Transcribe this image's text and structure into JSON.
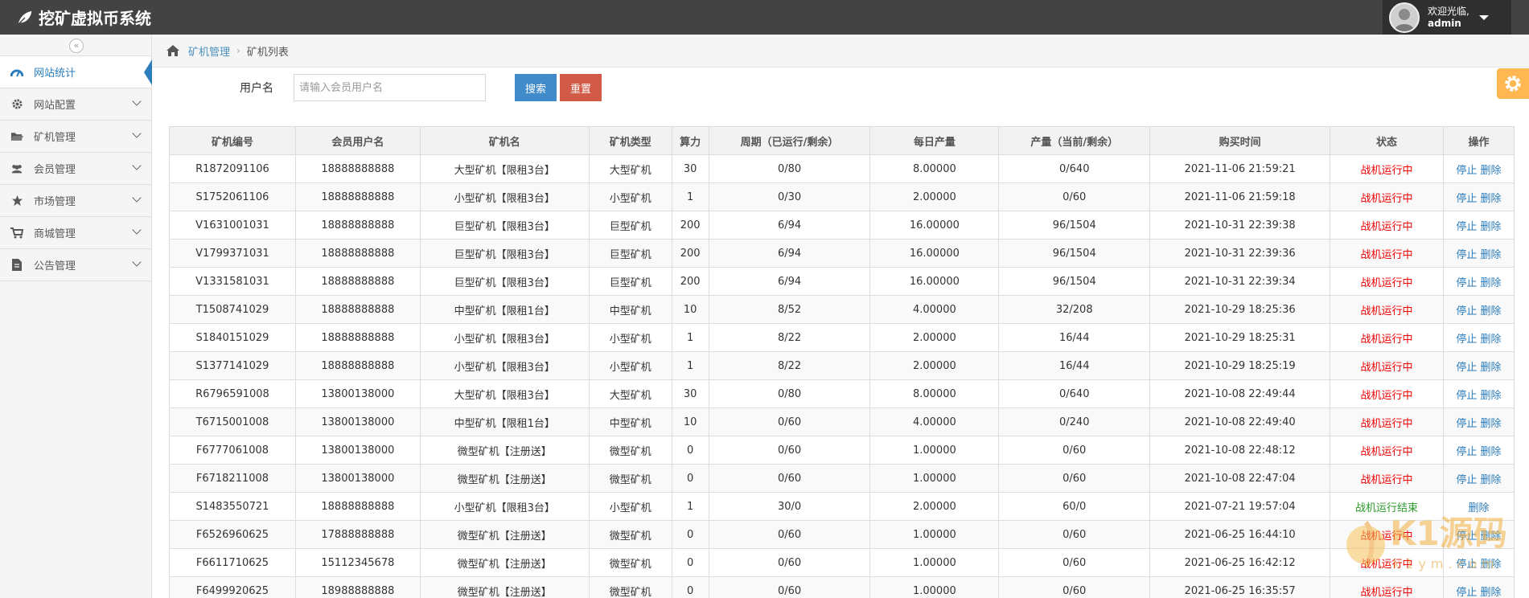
{
  "header": {
    "title": "挖矿虚拟币系统",
    "welcome": "欢迎光临,",
    "username": "admin"
  },
  "sidebar": {
    "collapse_icon": "«",
    "items": [
      {
        "label": "网站统计",
        "icon": "dashboard-icon",
        "active": true
      },
      {
        "label": "网站配置",
        "icon": "gear-icon"
      },
      {
        "label": "矿机管理",
        "icon": "folder-icon"
      },
      {
        "label": "会员管理",
        "icon": "users-icon"
      },
      {
        "label": "市场管理",
        "icon": "star-icon"
      },
      {
        "label": "商城管理",
        "icon": "cart-icon"
      },
      {
        "label": "公告管理",
        "icon": "document-icon"
      }
    ]
  },
  "breadcrumb": {
    "parent": "矿机管理",
    "sep": "›",
    "current": "矿机列表"
  },
  "search": {
    "label": "用户名",
    "placeholder": "请输入会员用户名",
    "search_btn": "搜索",
    "reset_btn": "重置"
  },
  "table": {
    "columns": [
      "矿机编号",
      "会员用户名",
      "矿机名",
      "矿机类型",
      "算力",
      "周期（已运行/剩余）",
      "每日产量",
      "产量（当前/剩余）",
      "购买时间",
      "状态",
      "操作"
    ],
    "stop_label": "停止",
    "delete_label": "删除",
    "rows": [
      [
        "R1872091106",
        "18888888888",
        "大型矿机【限租3台】",
        "大型矿机",
        "30",
        "0/80",
        "8.00000",
        "0/640",
        "2021-11-06 21:59:21",
        "战机运行中"
      ],
      [
        "S1752061106",
        "18888888888",
        "小型矿机【限租3台】",
        "小型矿机",
        "1",
        "0/30",
        "2.00000",
        "0/60",
        "2021-11-06 21:59:18",
        "战机运行中"
      ],
      [
        "V1631001031",
        "18888888888",
        "巨型矿机【限租3台】",
        "巨型矿机",
        "200",
        "6/94",
        "16.00000",
        "96/1504",
        "2021-10-31 22:39:38",
        "战机运行中"
      ],
      [
        "V1799371031",
        "18888888888",
        "巨型矿机【限租3台】",
        "巨型矿机",
        "200",
        "6/94",
        "16.00000",
        "96/1504",
        "2021-10-31 22:39:36",
        "战机运行中"
      ],
      [
        "V1331581031",
        "18888888888",
        "巨型矿机【限租3台】",
        "巨型矿机",
        "200",
        "6/94",
        "16.00000",
        "96/1504",
        "2021-10-31 22:39:34",
        "战机运行中"
      ],
      [
        "T1508741029",
        "18888888888",
        "中型矿机【限租1台】",
        "中型矿机",
        "10",
        "8/52",
        "4.00000",
        "32/208",
        "2021-10-29 18:25:36",
        "战机运行中"
      ],
      [
        "S1840151029",
        "18888888888",
        "小型矿机【限租3台】",
        "小型矿机",
        "1",
        "8/22",
        "2.00000",
        "16/44",
        "2021-10-29 18:25:31",
        "战机运行中"
      ],
      [
        "S1377141029",
        "18888888888",
        "小型矿机【限租3台】",
        "小型矿机",
        "1",
        "8/22",
        "2.00000",
        "16/44",
        "2021-10-29 18:25:19",
        "战机运行中"
      ],
      [
        "R6796591008",
        "13800138000",
        "大型矿机【限租3台】",
        "大型矿机",
        "30",
        "0/80",
        "8.00000",
        "0/640",
        "2021-10-08 22:49:44",
        "战机运行中"
      ],
      [
        "T6715001008",
        "13800138000",
        "中型矿机【限租1台】",
        "中型矿机",
        "10",
        "0/60",
        "4.00000",
        "0/240",
        "2021-10-08 22:49:40",
        "战机运行中"
      ],
      [
        "F6777061008",
        "13800138000",
        "微型矿机【注册送】",
        "微型矿机",
        "0",
        "0/60",
        "1.00000",
        "0/60",
        "2021-10-08 22:48:12",
        "战机运行中"
      ],
      [
        "F6718211008",
        "13800138000",
        "微型矿机【注册送】",
        "微型矿机",
        "0",
        "0/60",
        "1.00000",
        "0/60",
        "2021-10-08 22:47:04",
        "战机运行中"
      ],
      [
        "S1483550721",
        "18888888888",
        "小型矿机【限租3台】",
        "小型矿机",
        "1",
        "30/0",
        "2.00000",
        "60/0",
        "2021-07-21 19:57:04",
        "战机运行结束"
      ],
      [
        "F6526960625",
        "17888888888",
        "微型矿机【注册送】",
        "微型矿机",
        "0",
        "0/60",
        "1.00000",
        "0/60",
        "2021-06-25 16:44:10",
        "战机运行中"
      ],
      [
        "F6611710625",
        "15112345678",
        "微型矿机【注册送】",
        "微型矿机",
        "0",
        "0/60",
        "1.00000",
        "0/60",
        "2021-06-25 16:42:12",
        "战机运行中"
      ],
      [
        "F6499920625",
        "18988888888",
        "微型矿机【注册送】",
        "微型矿机",
        "0",
        "0/60",
        "1.00000",
        "0/60",
        "2021-06-25 16:35:57",
        "战机运行中"
      ]
    ]
  },
  "watermark": {
    "text": "K1源码",
    "sub": "k1ym.com"
  },
  "colors": {
    "accent": "#2b7dbc",
    "running": "#ee0000",
    "ended": "#2a9a2a",
    "search_btn": "#428bca",
    "reset_btn": "#d15b47"
  }
}
